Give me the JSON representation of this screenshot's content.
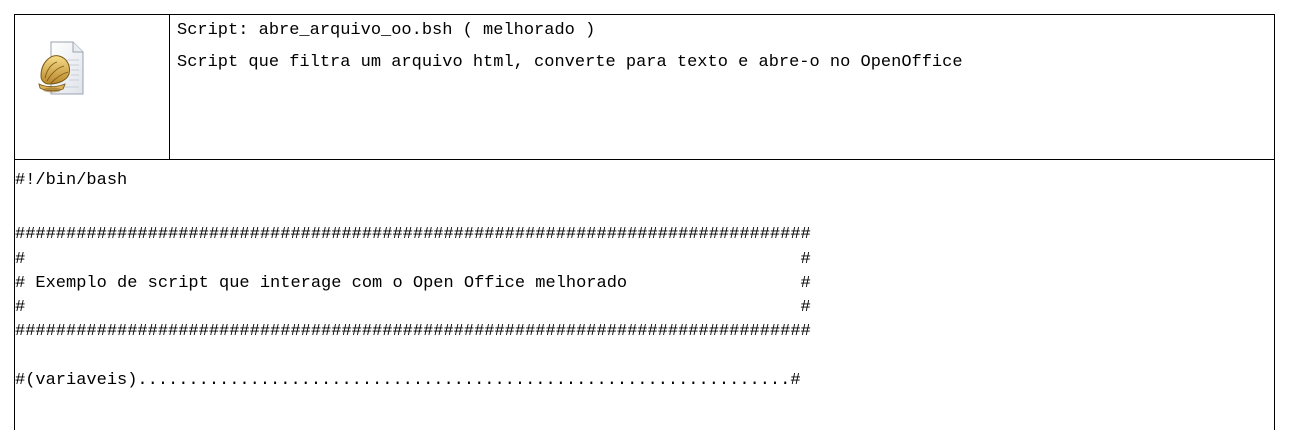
{
  "header": {
    "icon": "shell-script-file-icon",
    "title": "Script: abre_arquivo_oo.bsh ( melhorado )",
    "description": "Script que filtra um arquivo html, converte para texto e abre-o no OpenOffice"
  },
  "code": {
    "lines": [
      "#!/bin/bash",
      "",
      "##############################################################################",
      "#                                                                            #",
      "# Exemplo de script que interage com o Open Office melhorado                 #",
      "#                                                                            #",
      "##############################################################################",
      "",
      "#(variaveis)................................................................#"
    ]
  },
  "colors": {
    "border": "#000000",
    "text": "#000000",
    "background": "#ffffff"
  }
}
